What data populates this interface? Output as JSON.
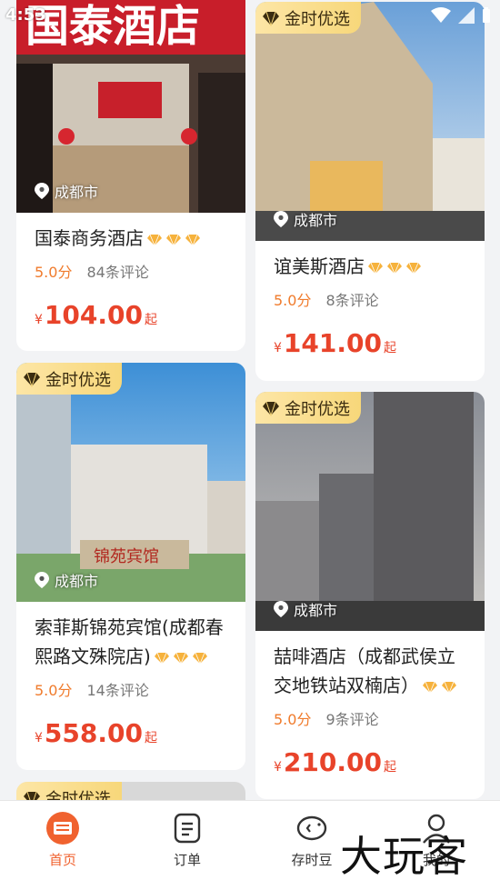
{
  "status": {
    "time": "4:53"
  },
  "hotels_left": [
    {
      "name": "国泰商务酒店",
      "badge": "",
      "city": "成都市",
      "gems": 3,
      "score": "5.0分",
      "reviews": "84条评论",
      "yen": "¥",
      "price": "104.00",
      "qi": "起"
    },
    {
      "name": "索菲斯锦苑宾馆(成都春熙路文殊院店)",
      "badge": "金时优选",
      "city": "成都市",
      "gems": 3,
      "score": "5.0分",
      "reviews": "14条评论",
      "yen": "¥",
      "price": "558.00",
      "qi": "起"
    },
    {
      "badge": "金时优选"
    }
  ],
  "hotels_right": [
    {
      "name": "谊美斯酒店",
      "badge": "金时优选",
      "city": "成都市",
      "gems": 3,
      "score": "5.0分",
      "reviews": "8条评论",
      "yen": "¥",
      "price": "141.00",
      "qi": "起"
    },
    {
      "name": "喆啡酒店（成都武侯立交地铁站双楠店）",
      "badge": "金时优选",
      "city": "成都市",
      "gems": 2,
      "score": "5.0分",
      "reviews": "9条评论",
      "yen": "¥",
      "price": "210.00",
      "qi": "起"
    }
  ],
  "tabbar": {
    "home": "首页",
    "orders": "订单",
    "beans": "存时豆",
    "mine": "我的"
  },
  "watermark": "大玩客",
  "colors": {
    "accent": "#f0622f",
    "price": "#e8432a",
    "score": "#f07b2c",
    "badge": "#f7d77a"
  }
}
